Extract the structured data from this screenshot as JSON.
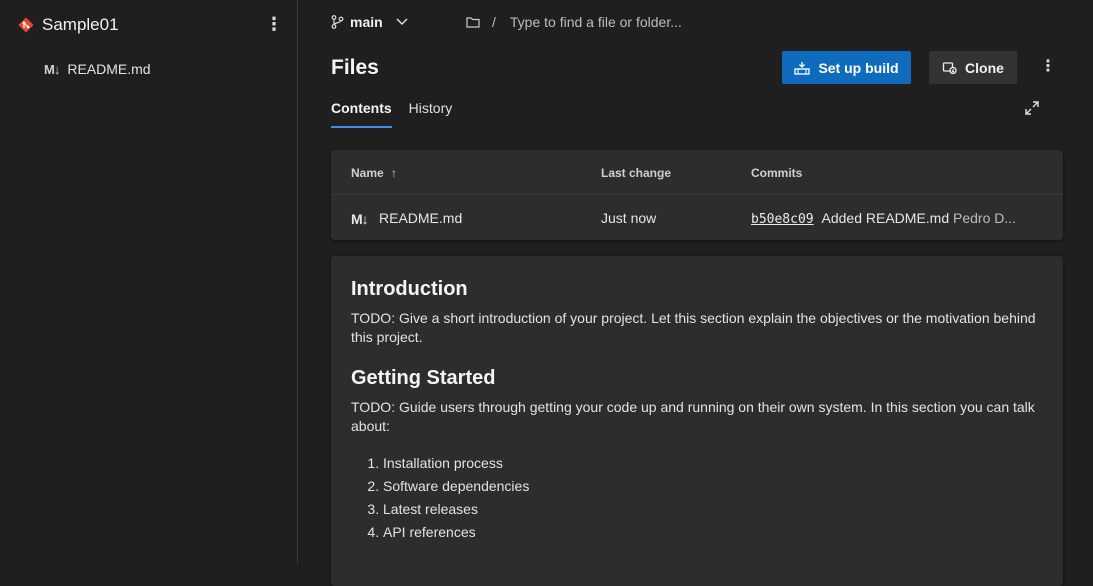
{
  "sidebar": {
    "repo_name": "Sample01",
    "items": [
      {
        "icon": "M↓",
        "label": "README.md"
      }
    ]
  },
  "toolbar": {
    "branch": "main",
    "path_separator": "/",
    "path_placeholder": "Type to find a file or folder...",
    "page_title": "Files",
    "setup_build_label": "Set up build",
    "clone_label": "Clone"
  },
  "tabs": [
    {
      "label": "Contents",
      "active": true
    },
    {
      "label": "History",
      "active": false
    }
  ],
  "files_table": {
    "headers": {
      "name": "Name",
      "sort_arrow": "↑",
      "last_change": "Last change",
      "commits": "Commits"
    },
    "rows": [
      {
        "icon": "M↓",
        "name": "README.md",
        "last_change": "Just now",
        "commit_hash": "b50e8c09",
        "commit_message": "Added README.md",
        "author": "Pedro D..."
      }
    ]
  },
  "readme": {
    "intro_heading": "Introduction",
    "intro_text": "TODO: Give a short introduction of your project. Let this section explain the objectives or the motivation behind this project.",
    "gs_heading": "Getting Started",
    "gs_text": "TODO: Guide users through getting your code up and running on their own system. In this section you can talk about:",
    "list": [
      "Installation process",
      "Software dependencies",
      "Latest releases",
      "API references"
    ]
  },
  "colors": {
    "accent": "#0f6cbd",
    "tab_underline": "#3b8eea",
    "git_logo": "#e8492c"
  }
}
